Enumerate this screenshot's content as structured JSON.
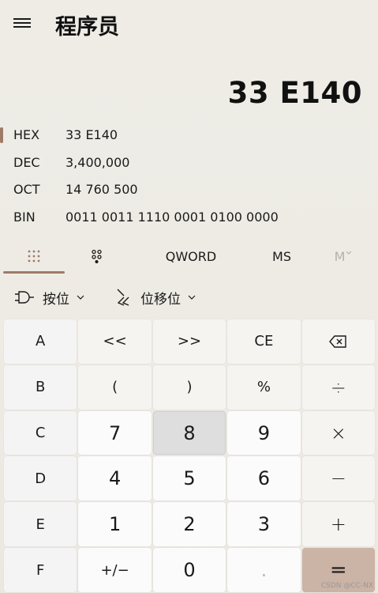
{
  "header": {
    "title": "程序员",
    "menu_icon": "hamburger-icon"
  },
  "display": {
    "value": "33 E140"
  },
  "radix": [
    {
      "label": "HEX",
      "value": "33 E140",
      "active": true
    },
    {
      "label": "DEC",
      "value": "3,400,000",
      "active": false
    },
    {
      "label": "OCT",
      "value": "14 760 500",
      "active": false
    },
    {
      "label": "BIN",
      "value": "0011 0011 1110 0001 0100 0000",
      "active": false
    }
  ],
  "modes": {
    "keypad_icon": "full-keypad-icon",
    "bitflip_icon": "bit-toggle-keypad-icon",
    "word_size": "QWORD",
    "ms_label": "MS",
    "mlist_label": "M"
  },
  "toolbar": {
    "bitwise_label": "按位",
    "bitshift_label": "位移位"
  },
  "keys": [
    [
      "A",
      "<<",
      ">>",
      "CE",
      "⌫"
    ],
    [
      "B",
      "(",
      ")",
      "%",
      "÷"
    ],
    [
      "C",
      "7",
      "8",
      "9",
      "×"
    ],
    [
      "D",
      "4",
      "5",
      "6",
      "−"
    ],
    [
      "E",
      "1",
      "2",
      "3",
      "+"
    ],
    [
      "F",
      "+/−",
      "0",
      ".",
      "="
    ]
  ],
  "watermark": "CSDN @CC-NX",
  "colors": {
    "accent": "#a07a68",
    "equals_bg": "#cbb3a6",
    "background": "#ece9e3"
  }
}
